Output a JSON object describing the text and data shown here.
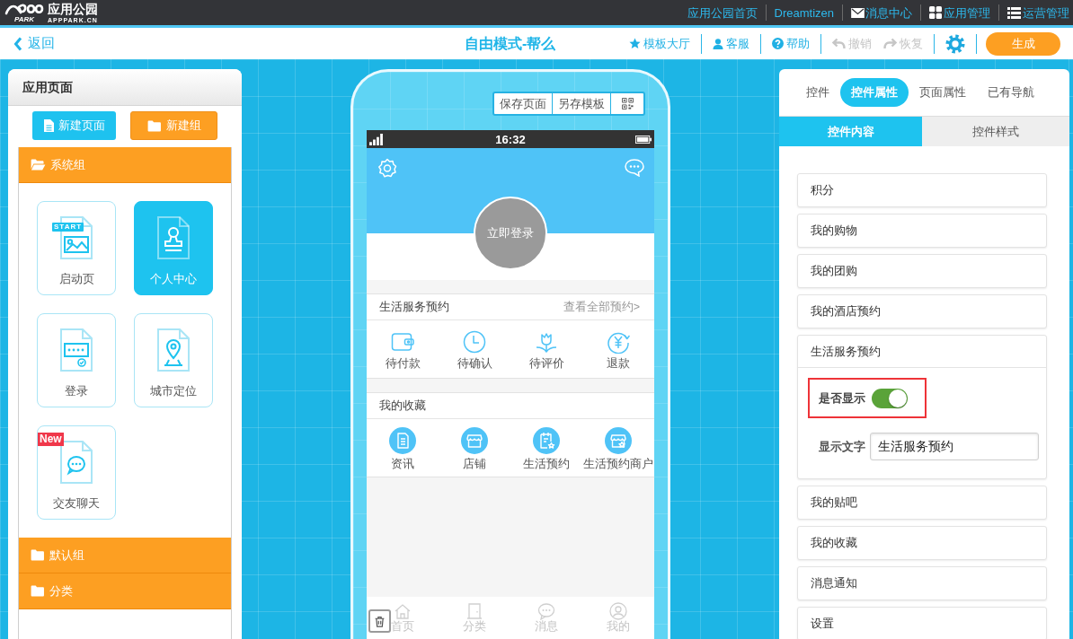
{
  "top_bar": {
    "logo": {
      "mark": "PARK",
      "name": "应用公园",
      "domain": "APPPARK.CN"
    },
    "links": [
      {
        "label": "应用公园首页"
      },
      {
        "label": "Dreamtizen"
      },
      {
        "label": "消息中心"
      },
      {
        "label": "应用管理"
      },
      {
        "label": "运营管理"
      }
    ]
  },
  "toolbar": {
    "back": "返回",
    "title": "自由模式-帮么",
    "actions": [
      {
        "label": "模板大厅",
        "disabled": false
      },
      {
        "label": "客服",
        "disabled": false
      },
      {
        "label": "帮助",
        "disabled": false
      },
      {
        "label": "撤销",
        "disabled": true
      },
      {
        "label": "恢复",
        "disabled": true
      }
    ],
    "generate": "生成"
  },
  "left_panel": {
    "title": "应用页面",
    "buttons": [
      {
        "label": "新建页面",
        "kind": "page"
      },
      {
        "label": "新建组",
        "kind": "group"
      }
    ],
    "groups": [
      {
        "label": "系统组",
        "expanded": true,
        "pages": [
          {
            "label": "启动页",
            "selected": false,
            "tag": "START"
          },
          {
            "label": "个人中心",
            "selected": true
          },
          {
            "label": "登录",
            "selected": false
          },
          {
            "label": "城市定位",
            "selected": false
          },
          {
            "label": "交友聊天",
            "selected": false,
            "badge": "New"
          }
        ]
      },
      {
        "label": "默认组",
        "expanded": false
      },
      {
        "label": "分类",
        "expanded": false
      }
    ]
  },
  "phone": {
    "actions": [
      "保存页面",
      "另存模板"
    ],
    "status_bar": {
      "time": "16:32"
    },
    "login": "立即登录",
    "sections": [
      {
        "kind": "outline",
        "title": "生活服务预约",
        "link": "查看全部预约>",
        "items": [
          "待付款",
          "待确认",
          "待评价",
          "退款"
        ]
      },
      {
        "kind": "filled",
        "title": "我的收藏",
        "items": [
          "资讯",
          "店铺",
          "生活预约",
          "生活预约商户"
        ]
      }
    ],
    "tab_bar": [
      "首页",
      "分类",
      "消息",
      "我的"
    ]
  },
  "right_panel": {
    "tabs": [
      {
        "label": "控件",
        "selected": false
      },
      {
        "label": "控件属性",
        "selected": true
      },
      {
        "label": "页面属性",
        "selected": false
      },
      {
        "label": "已有导航",
        "selected": false
      }
    ],
    "subtabs": [
      {
        "label": "控件内容",
        "selected": true
      },
      {
        "label": "控件样式",
        "selected": false
      }
    ],
    "items": [
      {
        "label": "积分",
        "expanded": false
      },
      {
        "label": "我的购物",
        "expanded": false
      },
      {
        "label": "我的团购",
        "expanded": false
      },
      {
        "label": "我的酒店预约",
        "expanded": false
      },
      {
        "label": "生活服务预约",
        "expanded": true,
        "fields": [
          {
            "kind": "toggle",
            "label": "是否显示",
            "on": true,
            "highlighted": true
          },
          {
            "kind": "text",
            "label": "显示文字",
            "value": "生活服务预约"
          }
        ]
      },
      {
        "label": "我的贴吧",
        "expanded": false
      },
      {
        "label": "我的收藏",
        "expanded": false
      },
      {
        "label": "消息通知",
        "expanded": false
      },
      {
        "label": "设置",
        "expanded": false
      }
    ]
  }
}
